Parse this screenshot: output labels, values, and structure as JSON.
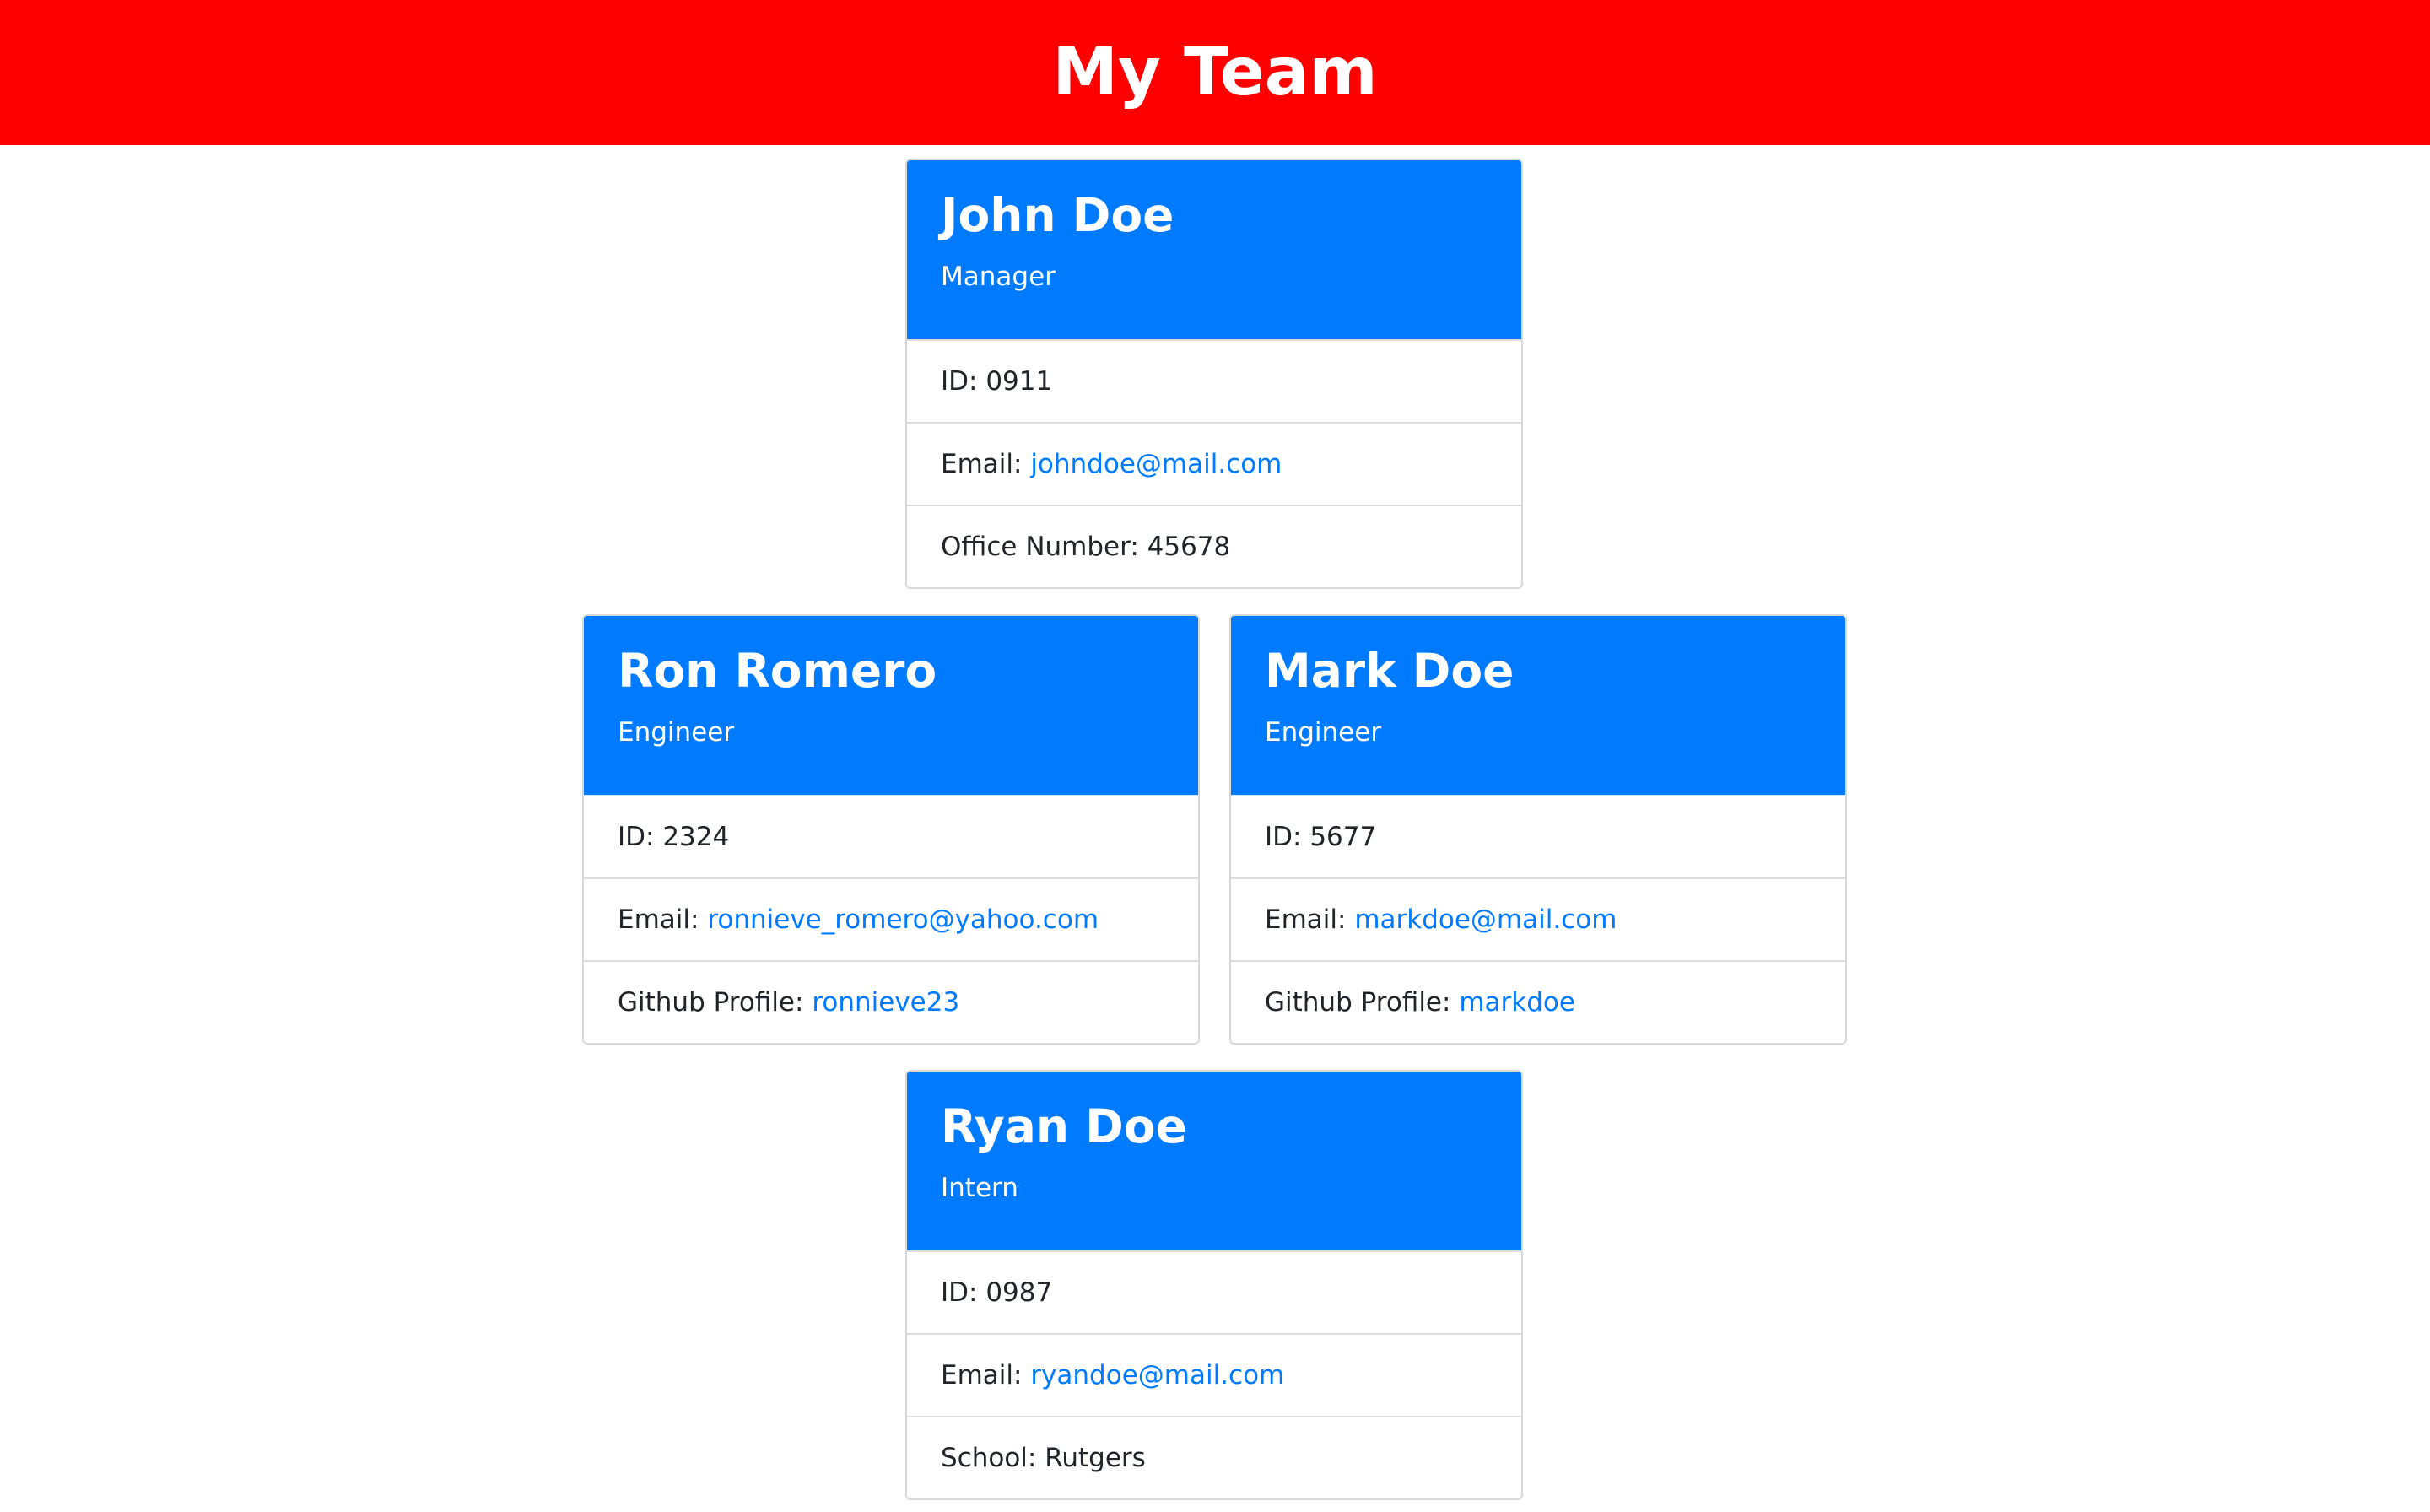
{
  "header": {
    "title": "My Team"
  },
  "colors": {
    "header_bg": "#ff0000",
    "card_head_bg": "#007bff",
    "link": "#007bff"
  },
  "cards": [
    {
      "name": "John Doe",
      "role": "Manager",
      "id_label": "ID: ",
      "id_value": "0911",
      "email_label": "Email: ",
      "email": "johndoe@mail.com",
      "extra_label": "Office Number: ",
      "extra_value": "45678"
    },
    {
      "name": "Ron Romero",
      "role": "Engineer",
      "id_label": "ID: ",
      "id_value": "2324",
      "email_label": "Email: ",
      "email": "ronnieve_romero@yahoo.com",
      "extra_label": "Github Profile: ",
      "extra_value": "ronnieve23"
    },
    {
      "name": "Mark Doe",
      "role": "Engineer",
      "id_label": "ID: ",
      "id_value": "5677",
      "email_label": "Email: ",
      "email": "markdoe@mail.com",
      "extra_label": "Github Profile: ",
      "extra_value": "markdoe"
    },
    {
      "name": "Ryan Doe",
      "role": "Intern",
      "id_label": "ID: ",
      "id_value": "0987",
      "email_label": "Email: ",
      "email": "ryandoe@mail.com",
      "extra_label": "School: ",
      "extra_value": "Rutgers"
    }
  ]
}
